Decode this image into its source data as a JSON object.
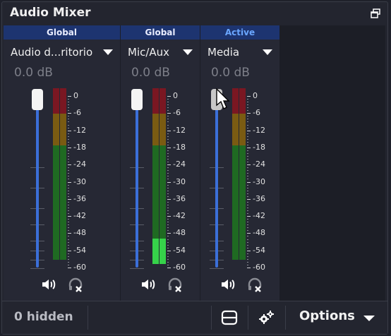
{
  "dock": {
    "title": "Audio Mixer",
    "float_icon": "undock-icon"
  },
  "channels": [
    {
      "header": "Global",
      "name": "Audio d...ritorio",
      "volume": "0.0 dB",
      "meter_peak_db": -60
    },
    {
      "header": "Global",
      "name": "Mic/Aux",
      "volume": "0.0 dB",
      "meter_peak_db": -54
    },
    {
      "header": "Active",
      "name": "Media",
      "volume": "0.0 dB",
      "meter_peak_db": -60
    }
  ],
  "scale": [
    "0",
    "-6",
    "-12",
    "-18",
    "-24",
    "-30",
    "-36",
    "-42",
    "-48",
    "-54",
    "-60"
  ],
  "status": {
    "hidden_label": "0 hidden",
    "options_label": "Options"
  },
  "colors": {
    "header_bg": "#1d3470",
    "active_text": "#6aa6ff",
    "slider": "#3b6fd8",
    "meter_red": "#7a1722",
    "meter_yellow": "#7a5b12",
    "meter_green": "#1f6a22",
    "meter_level": "#36d24a"
  }
}
